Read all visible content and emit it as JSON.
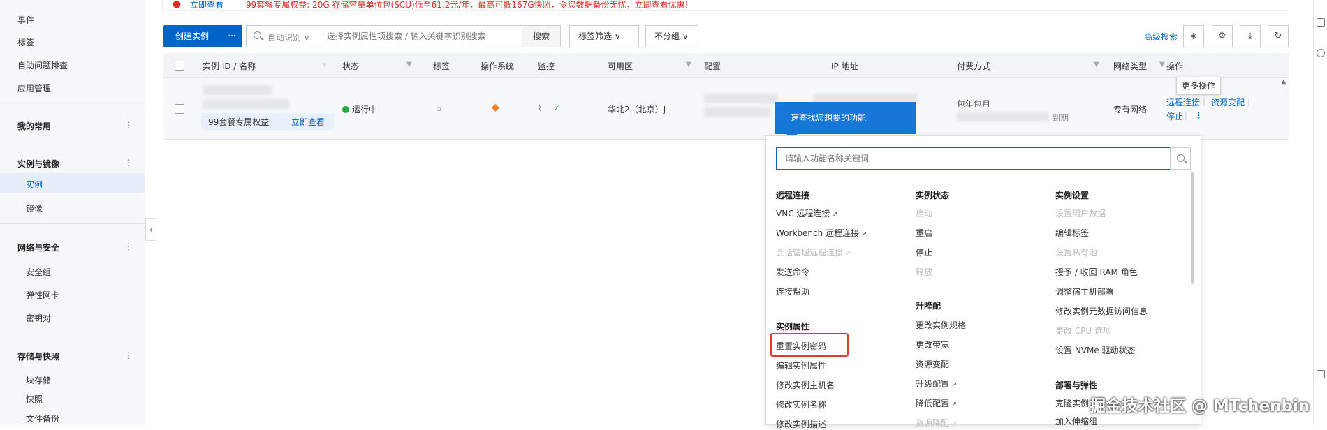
{
  "sidebar": {
    "top_items": [
      "事件",
      "标签",
      "自助问题排查",
      "应用管理"
    ],
    "groups": [
      {
        "title": "我的常用",
        "items": []
      },
      {
        "title": "实例与镜像",
        "items": [
          "实例",
          "镜像"
        ]
      },
      {
        "title": "网络与安全",
        "items": [
          "安全组",
          "弹性网卡",
          "密钥对"
        ]
      },
      {
        "title": "存储与快照",
        "items": [
          "块存储",
          "快照",
          "文件备份"
        ]
      }
    ],
    "active": "实例",
    "collapse_glyph": "‹",
    "dots": "⋮"
  },
  "banner": {
    "link": "立即查看",
    "text": "99套餐专属权益: 20G 存储容量单位包(SCU)低至61.2元/年，最高可抵167G快照，令您数据备份无忧，立即查看优惠!"
  },
  "toolbar": {
    "create_label": "创建实例",
    "more_glyph": "···",
    "search_select": "自动识别 ∨",
    "search_placeholder": "选择实例属性项搜索 / 输入关键字识别搜索",
    "search_btn": "搜索",
    "filter_label": "标签筛选 ∨",
    "group_label": "不分组 ∨",
    "advanced_search": "高级搜索"
  },
  "table": {
    "headers": [
      "实例 ID / 名称",
      "状态",
      "标签",
      "操作系统",
      "监控",
      "可用区",
      "配置",
      "IP 地址",
      "付费方式",
      "网络类型",
      "操作"
    ],
    "row": {
      "status": "运行中",
      "zone": "华北2（北京）J",
      "billing": "包年包月",
      "billing_tail": "到期",
      "network": "专有网络",
      "promo_text": "99套餐专属权益",
      "promo_link": "立即查看",
      "action_remote": "远程连接",
      "action_resize": "资源变配",
      "action_stop": "停止",
      "action_more": "⋮"
    }
  },
  "tooltip": "更多操作",
  "quick_tip": "速查找您想要的功能",
  "panel": {
    "search_placeholder": "请输入功能名称关键词",
    "columns": [
      {
        "sections": [
          {
            "title": "远程连接",
            "items": [
              {
                "label": "VNC 远程连接",
                "ext": true,
                "disabled": false
              },
              {
                "label": "Workbench 远程连接",
                "ext": true,
                "disabled": false
              },
              {
                "label": "会话管理远程连接",
                "ext": true,
                "disabled": true
              },
              {
                "label": "发送命令",
                "ext": false,
                "disabled": false
              },
              {
                "label": "连接帮助",
                "ext": false,
                "disabled": false
              }
            ]
          },
          {
            "title": "实例属性",
            "items": [
              {
                "label": "重置实例密码",
                "ext": false,
                "disabled": false
              },
              {
                "label": "编辑实例属性",
                "ext": false,
                "disabled": false
              },
              {
                "label": "修改实例主机名",
                "ext": false,
                "disabled": false
              },
              {
                "label": "修改实例名称",
                "ext": false,
                "disabled": false
              },
              {
                "label": "修改实例描述",
                "ext": false,
                "disabled": false
              }
            ]
          }
        ]
      },
      {
        "sections": [
          {
            "title": "实例状态",
            "items": [
              {
                "label": "启动",
                "ext": false,
                "disabled": true
              },
              {
                "label": "重启",
                "ext": false,
                "disabled": false
              },
              {
                "label": "停止",
                "ext": false,
                "disabled": false
              },
              {
                "label": "释放",
                "ext": false,
                "disabled": true
              }
            ]
          },
          {
            "title": "升降配",
            "items": [
              {
                "label": "更改实例规格",
                "ext": false,
                "disabled": false
              },
              {
                "label": "更改带宽",
                "ext": false,
                "disabled": false
              },
              {
                "label": "资源变配",
                "ext": false,
                "disabled": false
              },
              {
                "label": "升级配置",
                "ext": true,
                "disabled": false
              },
              {
                "label": "降低配置",
                "ext": true,
                "disabled": false
              },
              {
                "label": "资源降配",
                "ext": true,
                "disabled": true
              }
            ]
          }
        ]
      },
      {
        "sections": [
          {
            "title": "实例设置",
            "items": [
              {
                "label": "设置用户数据",
                "ext": false,
                "disabled": true
              },
              {
                "label": "编辑标签",
                "ext": false,
                "disabled": false
              },
              {
                "label": "设置私有池",
                "ext": false,
                "disabled": true
              },
              {
                "label": "授予 / 收回 RAM 角色",
                "ext": false,
                "disabled": false
              },
              {
                "label": "调整宿主机部署",
                "ext": false,
                "disabled": false
              },
              {
                "label": "修改实例元数据访问信息",
                "ext": false,
                "disabled": false
              },
              {
                "label": "更改 CPU 选项",
                "ext": false,
                "disabled": true
              },
              {
                "label": "设置 NVMe 驱动状态",
                "ext": false,
                "disabled": false
              }
            ]
          },
          {
            "title": "部署与弹性",
            "items": [
              {
                "label": "克隆实例",
                "ext": false,
                "disabled": false
              },
              {
                "label": "加入伸缩组",
                "ext": false,
                "disabled": false
              }
            ]
          }
        ]
      }
    ]
  },
  "watermark": "掘金技术社区 @ MTchenbin"
}
